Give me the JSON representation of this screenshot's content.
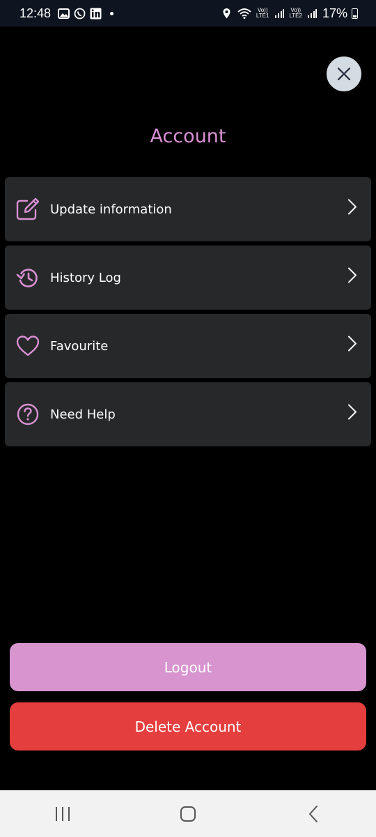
{
  "status_bar": {
    "time": "12:48",
    "sim1_top": "Vo))",
    "sim1_bottom": "LTE1",
    "sim2_top": "Vo))",
    "sim2_bottom": "LTE2",
    "battery_percent": "17%",
    "icons": [
      "gallery-icon",
      "whatsapp-icon",
      "linkedin-icon",
      "notification-dot",
      "location-icon",
      "wifi-icon",
      "signal-icon",
      "battery-icon"
    ]
  },
  "title": "Account",
  "menu": [
    {
      "label": "Update information",
      "icon": "edit-icon"
    },
    {
      "label": "History Log",
      "icon": "history-icon"
    },
    {
      "label": "Favourite",
      "icon": "heart-icon"
    },
    {
      "label": "Need Help",
      "icon": "help-icon"
    }
  ],
  "buttons": {
    "logout": "Logout",
    "delete": "Delete Account"
  },
  "colors": {
    "accent": "#d98fd3",
    "logout_bg": "#d794cf",
    "delete_bg": "#e53e3e",
    "card_bg": "#262829",
    "background": "#000000"
  },
  "nav": [
    "recent-apps-icon",
    "home-icon",
    "back-icon"
  ]
}
